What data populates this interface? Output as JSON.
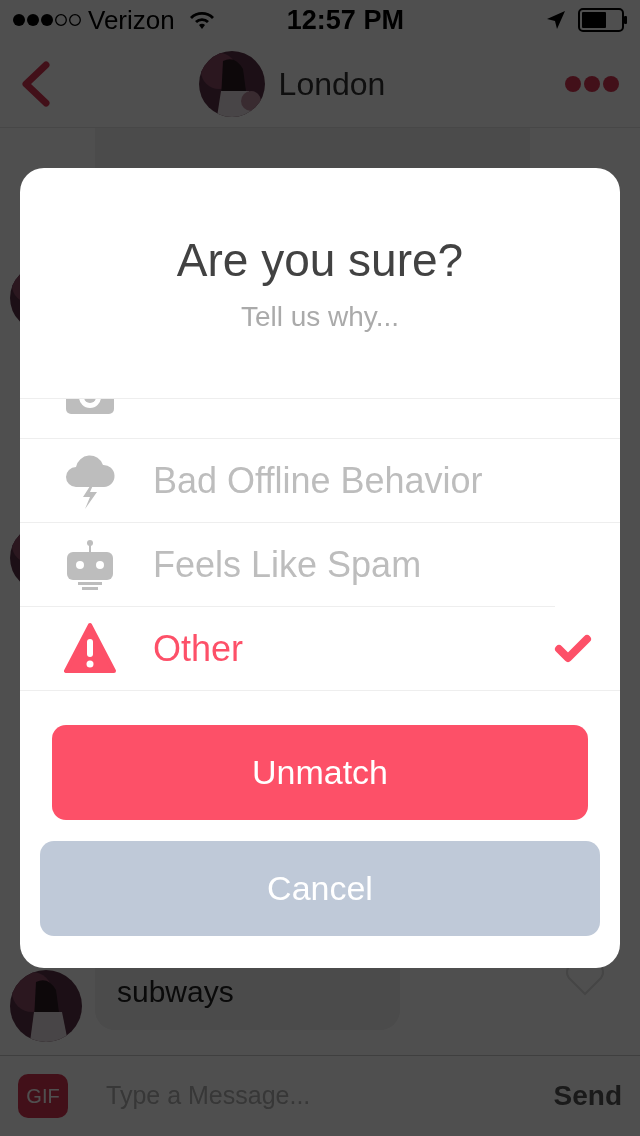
{
  "status_bar": {
    "carrier": "Verizon",
    "time": "12:57 PM"
  },
  "nav": {
    "title": "London"
  },
  "messages": [
    {
      "text": "subways"
    }
  ],
  "composer": {
    "gif": "GIF",
    "placeholder": "Type a Message...",
    "send": "Send"
  },
  "dialog": {
    "title": "Are you sure?",
    "subtitle": "Tell us why...",
    "reasons": [
      {
        "kind": "camera",
        "selected": false
      },
      {
        "label": "Bad Offline Behavior",
        "kind": "storm",
        "selected": false
      },
      {
        "label": "Feels Like Spam",
        "kind": "robot",
        "selected": false
      },
      {
        "label": "Other",
        "kind": "warning",
        "selected": true
      }
    ],
    "buttons": [
      {
        "label": "Unmatch",
        "kind": "primary"
      },
      {
        "label": "Cancel",
        "kind": "secondary"
      }
    ]
  }
}
